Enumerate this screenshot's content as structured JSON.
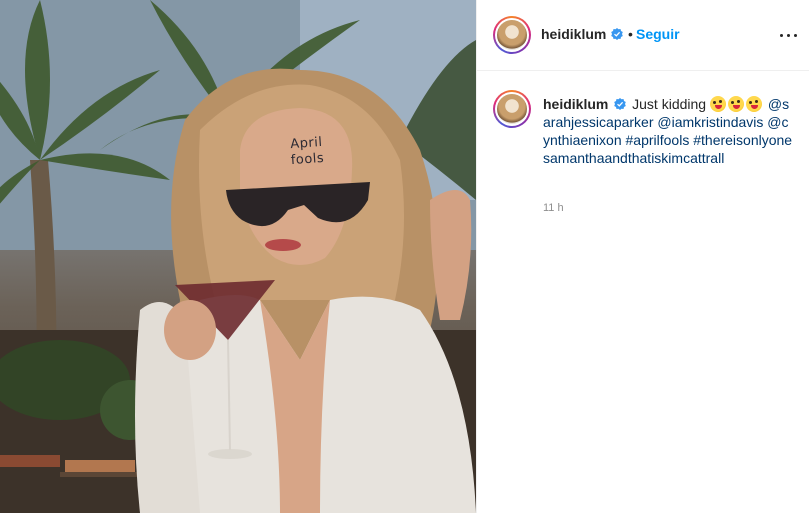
{
  "post": {
    "media": {
      "forehead_line1": "April",
      "forehead_line2": "fools"
    },
    "header": {
      "username": "heidiklum",
      "separator": "•",
      "follow_label": "Seguir",
      "more_icon": "ellipsis-icon",
      "verified_icon": "verified-badge-icon"
    },
    "caption": {
      "username": "heidiklum",
      "text": "Just kidding",
      "emoji": [
        "winking-tongue-emoji",
        "winking-tongue-emoji",
        "winking-tongue-emoji"
      ],
      "mentions": [
        "@sarahjessicaparker",
        "@iamkristindavis",
        "@cynthiaenixon"
      ],
      "hashtags": [
        "#aprilfools",
        "#thereisonlyonesamanthaandthatiskimcattrall"
      ]
    },
    "timestamp": "11 h"
  },
  "colors": {
    "accent": "#0095f6",
    "link": "#00376b",
    "verified": "#3897f0",
    "muted": "#8e8e8e",
    "text": "#262626"
  }
}
